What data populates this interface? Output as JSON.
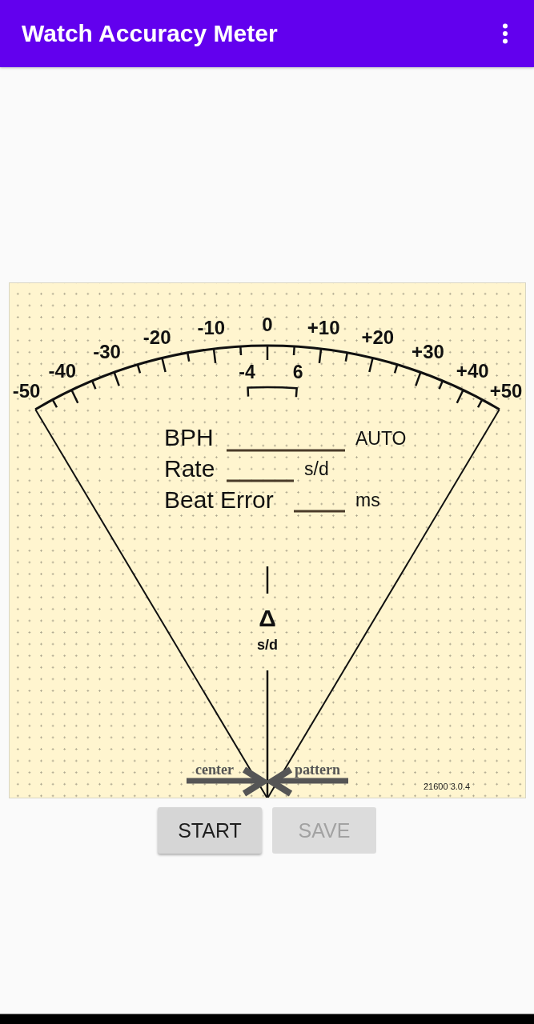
{
  "app_bar": {
    "title": "Watch Accuracy Meter"
  },
  "meter": {
    "scale_labels": [
      "-50",
      "-40",
      "-30",
      "-20",
      "-10",
      "0",
      "+10",
      "+20",
      "+30",
      "+40",
      "+50"
    ],
    "range_labels": [
      "-4",
      "6"
    ],
    "readings": [
      {
        "label": "BPH",
        "unit": "AUTO"
      },
      {
        "label": "Rate",
        "unit": "s/d"
      },
      {
        "label": "Beat Error",
        "unit": "ms"
      }
    ],
    "delta": {
      "symbol": "Δ",
      "unit": "s/d"
    },
    "arrow_labels": [
      "center",
      "pattern"
    ],
    "version": "21600 3.0.4"
  },
  "buttons": [
    {
      "label": "START",
      "disabled": false
    },
    {
      "label": "SAVE",
      "disabled": true
    }
  ]
}
